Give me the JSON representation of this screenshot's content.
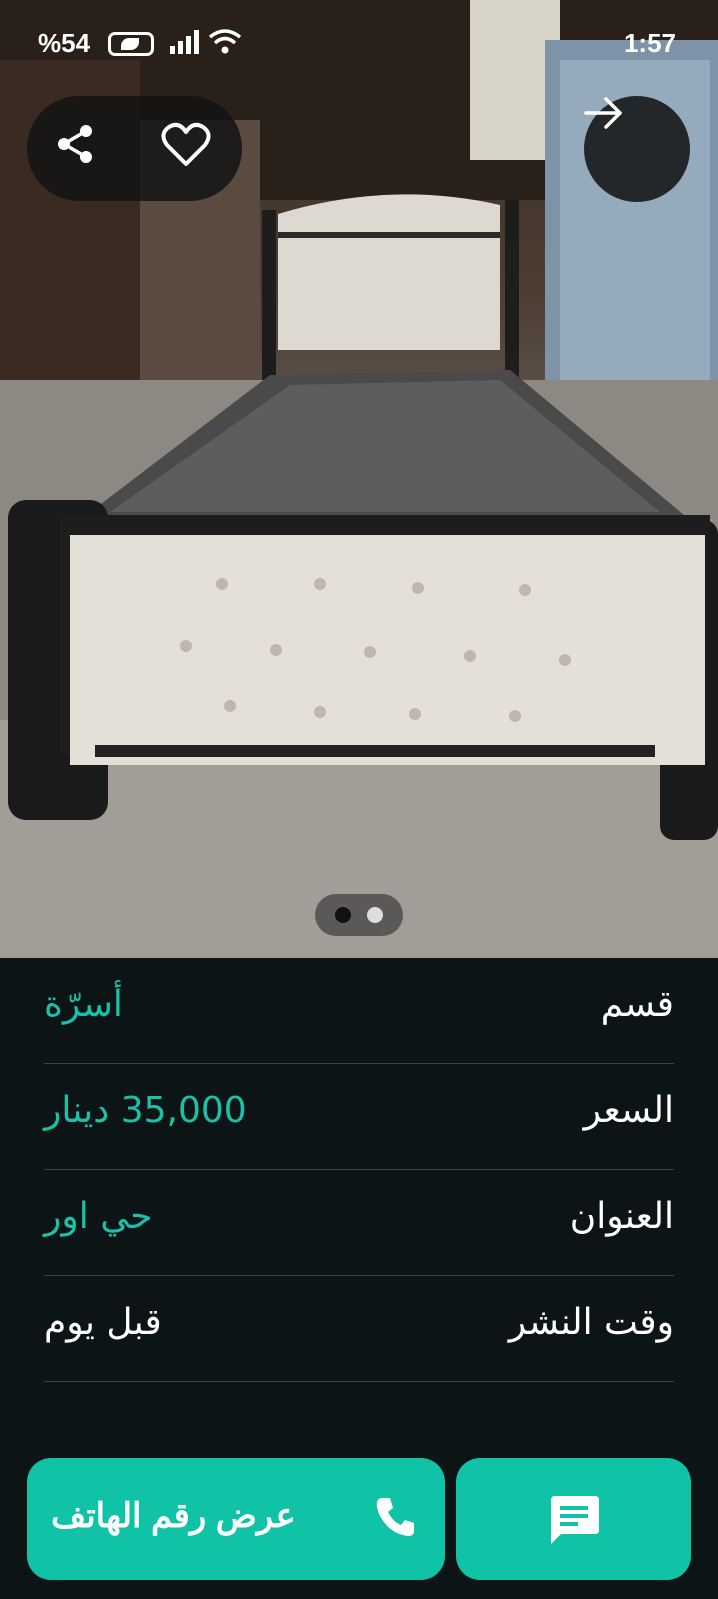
{
  "status_bar": {
    "battery": "%54",
    "time": "1:57"
  },
  "listing_image": {
    "carousel_count": 2,
    "carousel_active": 1
  },
  "details": [
    {
      "label": "قسم",
      "value": "أسرّة",
      "value_color": "#1bc0a8"
    },
    {
      "label": "السعر",
      "value": "35,000 دينار",
      "value_color": "#1bc0a8"
    },
    {
      "label": "العنوان",
      "value": "حي اور",
      "value_color": "#1bc0a8"
    },
    {
      "label": "وقت النشر",
      "value": "قبل يوم",
      "value_color": "#ffffff"
    }
  ],
  "actions": {
    "call_label": "عرض رقم الهاتف"
  },
  "colors": {
    "accent": "#11c3a6",
    "background": "#0d1416",
    "divider": "#3a4244"
  },
  "icons": {
    "share": "share-icon",
    "favorite": "heart-icon",
    "back": "arrow-right-icon",
    "phone": "phone-icon",
    "chat": "chat-icon"
  }
}
